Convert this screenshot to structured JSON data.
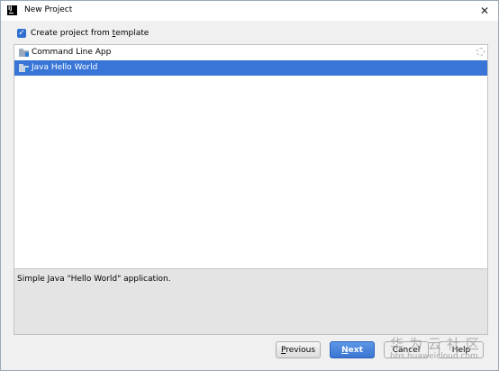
{
  "window": {
    "title": "New Project",
    "app_icon_text": "IJ"
  },
  "template_option": {
    "label_prefix": "Create project from ",
    "label_accel": "t",
    "label_suffix": "emplate",
    "checked": true
  },
  "templates": [
    {
      "label": "Command Line App",
      "selected": false
    },
    {
      "label": "Java Hello World",
      "selected": true
    }
  ],
  "description": "Simple Java \"Hello World\" application.",
  "buttons": {
    "previous": {
      "accel": "P",
      "rest": "revious"
    },
    "next": {
      "accel": "N",
      "rest": "ext"
    },
    "cancel": {
      "label": "Cancel"
    },
    "help": {
      "label": "Help"
    }
  },
  "watermark": {
    "chinese": "华为云社区",
    "url": "bbs.huaweicloud.com"
  },
  "colors": {
    "selection": "#3875d7",
    "primary_button": "#3a75d2",
    "checkbox": "#2f6fcf"
  }
}
